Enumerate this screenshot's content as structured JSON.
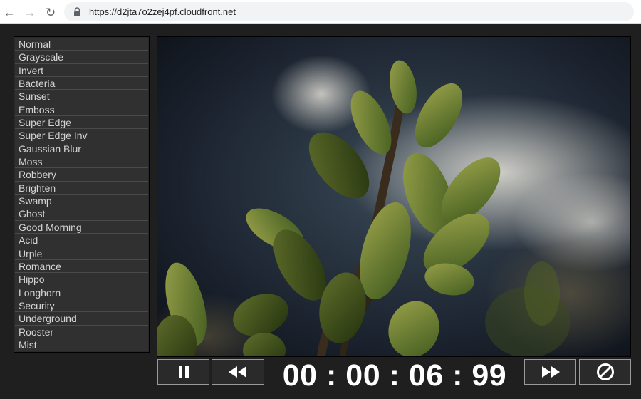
{
  "browser": {
    "url": "https://d2jta7o2zej4pf.cloudfront.net"
  },
  "filters": [
    "Normal",
    "Grayscale",
    "Invert",
    "Bacteria",
    "Sunset",
    "Emboss",
    "Super Edge",
    "Super Edge Inv",
    "Gaussian Blur",
    "Moss",
    "Robbery",
    "Brighten",
    "Swamp",
    "Ghost",
    "Good Morning",
    "Acid",
    "Urple",
    "Romance",
    "Hippo",
    "Longhorn",
    "Security",
    "Underground",
    "Rooster",
    "Mist"
  ],
  "player": {
    "timecode": "00 : 00 : 06 : 99"
  },
  "icons": {
    "back": "arrow-left-icon",
    "forward": "arrow-right-icon",
    "reload": "reload-icon",
    "lock": "lock-icon",
    "pause": "pause-icon",
    "rewind": "rewind-icon",
    "fast_forward": "fast-forward-icon",
    "stop": "stop-icon"
  },
  "colors": {
    "page_bg": "#1f1f1f",
    "list_item_bg": "#303030",
    "list_text": "#d4d4d4",
    "timecode": "#ffffff"
  }
}
